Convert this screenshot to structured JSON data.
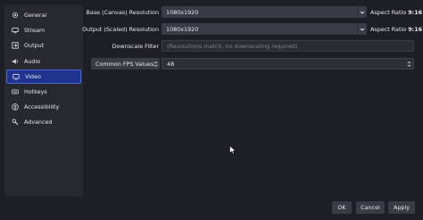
{
  "sidebar": {
    "items": [
      {
        "label": "General",
        "icon": "gear-icon"
      },
      {
        "label": "Stream",
        "icon": "stream-icon"
      },
      {
        "label": "Output",
        "icon": "output-icon"
      },
      {
        "label": "Audio",
        "icon": "speaker-icon"
      },
      {
        "label": "Video",
        "icon": "monitor-icon",
        "selected": true
      },
      {
        "label": "Hotkeys",
        "icon": "keyboard-icon"
      },
      {
        "label": "Accessibility",
        "icon": "accessibility-icon"
      },
      {
        "label": "Advanced",
        "icon": "wrench-icon"
      }
    ]
  },
  "video": {
    "base_resolution": {
      "label": "Base (Canvas) Resolution",
      "value": "1080x1920",
      "aspect_prefix": "Aspect Ratio",
      "aspect_value": "9:16"
    },
    "output_resolution": {
      "label": "Output (Scaled) Resolution",
      "value": "1080x1920",
      "aspect_prefix": "Aspect Ratio",
      "aspect_value": "9:16"
    },
    "downscale_filter": {
      "label": "Downscale Filter",
      "value": "(Resolutions match, no downscaling required)"
    },
    "fps": {
      "type_value": "Common FPS Values",
      "value": "48"
    }
  },
  "buttons": {
    "ok": "OK",
    "cancel": "Cancel",
    "apply": "Apply"
  },
  "colors": {
    "selected_bg": "#20348f",
    "selected_border": "#4a69d4",
    "background": "#1e1f26"
  }
}
